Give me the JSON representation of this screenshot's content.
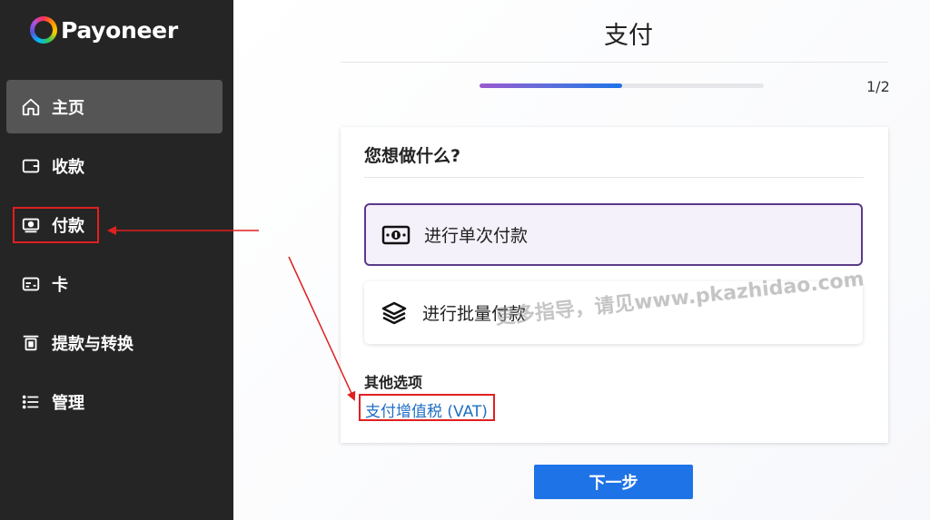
{
  "brand": {
    "name": "Payoneer"
  },
  "sidebar": {
    "items": [
      {
        "label": "主页",
        "icon": "home-icon",
        "active": true
      },
      {
        "label": "收款",
        "icon": "wallet-icon",
        "active": false
      },
      {
        "label": "付款",
        "icon": "payment-icon",
        "active": false
      },
      {
        "label": "卡",
        "icon": "card-icon",
        "active": false
      },
      {
        "label": "提款与转换",
        "icon": "withdraw-icon",
        "active": false
      },
      {
        "label": "管理",
        "icon": "list-icon",
        "active": false
      }
    ]
  },
  "main": {
    "title": "支付",
    "progress": {
      "step_text": "1/2",
      "fraction": 0.5
    },
    "card": {
      "heading": "您想做什么?",
      "options": [
        {
          "label": "进行单次付款",
          "icon": "banknote-icon",
          "selected": true
        },
        {
          "label": "进行批量付款",
          "icon": "layers-icon",
          "selected": false
        }
      ],
      "other_title": "其他选项",
      "vat_link": "支付增值税 (VAT)"
    },
    "next_button": "下一步"
  },
  "watermark": "更多指导，请见www.pkazhidao.com",
  "colors": {
    "sidebar_bg": "#252525",
    "active_item_bg": "#555555",
    "primary_blue": "#1e73e6",
    "selected_border": "#5a3a8a",
    "annotation_red": "#e02020",
    "link_blue": "#1f6fc4"
  }
}
